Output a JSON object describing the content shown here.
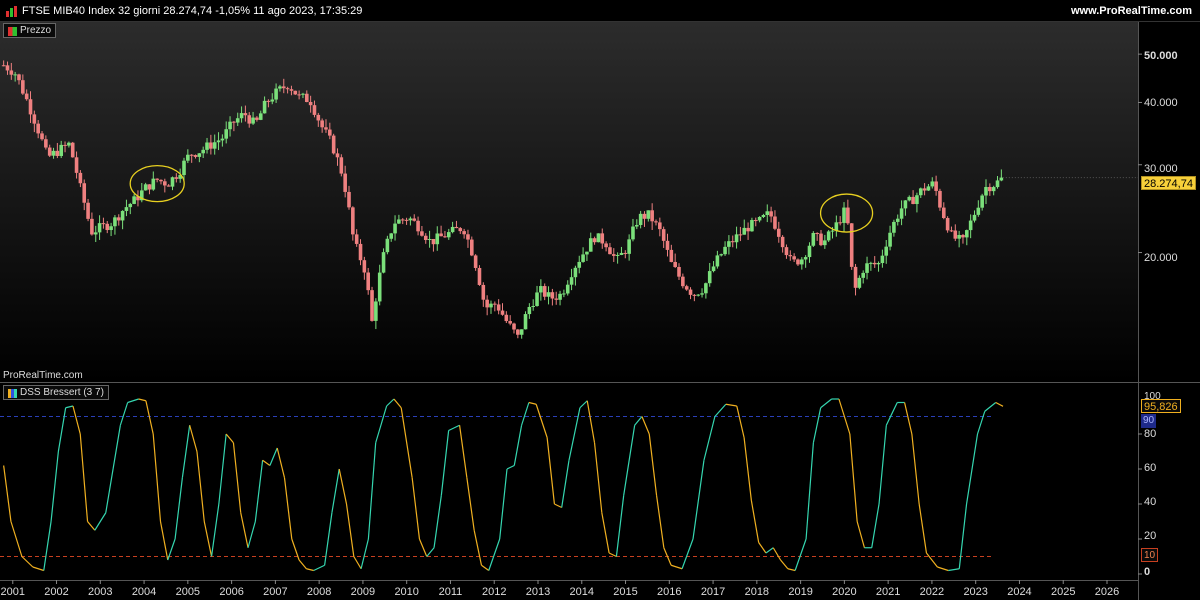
{
  "header": {
    "title": "FTSE MIB40 Index 32 giorni 28.274,74 -1,05% 11 ago 2023, 17:35:29",
    "site": "www.ProRealTime.com"
  },
  "price_panel": {
    "legend": "Prezzo",
    "watermark": "ProRealTime.com",
    "y_ticks": [
      "50.000",
      "40.000",
      "30.000",
      "20.000"
    ],
    "last_price": "28.274,74"
  },
  "indicator_panel": {
    "legend": "DSS Bressert (3 7)",
    "y_ticks": [
      "80",
      "60",
      "40",
      "20",
      "0"
    ],
    "top_tick": "100",
    "last_value": "95,826",
    "upper_level": "90",
    "lower_level": "10"
  },
  "x_axis": {
    "years": [
      "2001",
      "2002",
      "2003",
      "2004",
      "2005",
      "2006",
      "2007",
      "2008",
      "2009",
      "2010",
      "2011",
      "2012",
      "2013",
      "2014",
      "2015",
      "2016",
      "2017",
      "2018",
      "2019",
      "2020",
      "2021",
      "2022",
      "2023",
      "2024",
      "2025",
      "2026"
    ]
  },
  "colors": {
    "up": "#7be07b",
    "down": "#ef8080",
    "highlight": "#e8d020",
    "dss_up": "#35d6b0",
    "dss_down": "#f0b020",
    "upper_line": "#2a3fb8",
    "lower_line": "#c84020",
    "price_tag_bg": "#f7d03a",
    "grid_bg_top": "#2c2c2c"
  },
  "chart_data": [
    {
      "type": "candlestick",
      "title": "FTSE MIB40 Index 32 giorni",
      "scale": "log",
      "ylim": [
        11000,
        58000
      ],
      "x_range": [
        "2000-09",
        "2026-09"
      ],
      "closes": [
        [
          "2000-10",
          47500
        ],
        [
          "2001-01",
          46000
        ],
        [
          "2001-04",
          41000
        ],
        [
          "2001-07",
          36000
        ],
        [
          "2001-10",
          31000
        ],
        [
          "2002-01",
          32000
        ],
        [
          "2002-04",
          33000
        ],
        [
          "2002-07",
          27000
        ],
        [
          "2002-10",
          22000
        ],
        [
          "2003-01",
          22500
        ],
        [
          "2003-04",
          23000
        ],
        [
          "2003-07",
          24500
        ],
        [
          "2003-10",
          25500
        ],
        [
          "2004-01",
          27000
        ],
        [
          "2004-04",
          28000
        ],
        [
          "2004-07",
          27500
        ],
        [
          "2004-10",
          29000
        ],
        [
          "2005-01",
          31500
        ],
        [
          "2005-04",
          32000
        ],
        [
          "2005-07",
          33000
        ],
        [
          "2005-10",
          34000
        ],
        [
          "2006-01",
          36500
        ],
        [
          "2006-04",
          38000
        ],
        [
          "2006-07",
          36000
        ],
        [
          "2006-10",
          40000
        ],
        [
          "2007-01",
          42000
        ],
        [
          "2007-04",
          43500
        ],
        [
          "2007-07",
          41000
        ],
        [
          "2007-10",
          40500
        ],
        [
          "2008-01",
          36000
        ],
        [
          "2008-04",
          33000
        ],
        [
          "2008-07",
          28500
        ],
        [
          "2008-10",
          21000
        ],
        [
          "2009-01",
          18500
        ],
        [
          "2009-03",
          14500
        ],
        [
          "2009-06",
          19500
        ],
        [
          "2009-09",
          23000
        ],
        [
          "2010-01",
          23500
        ],
        [
          "2010-04",
          22500
        ],
        [
          "2010-07",
          21000
        ],
        [
          "2010-10",
          21500
        ],
        [
          "2011-01",
          22000
        ],
        [
          "2011-04",
          22500
        ],
        [
          "2011-07",
          19500
        ],
        [
          "2011-10",
          15500
        ],
        [
          "2012-01",
          15800
        ],
        [
          "2012-04",
          14500
        ],
        [
          "2012-07",
          13500
        ],
        [
          "2012-10",
          15500
        ],
        [
          "2013-01",
          16800
        ],
        [
          "2013-04",
          16200
        ],
        [
          "2013-07",
          16500
        ],
        [
          "2013-10",
          18500
        ],
        [
          "2014-01",
          20000
        ],
        [
          "2014-04",
          21500
        ],
        [
          "2014-07",
          21000
        ],
        [
          "2014-10",
          19200
        ],
        [
          "2015-01",
          20500
        ],
        [
          "2015-04",
          23500
        ],
        [
          "2015-07",
          23800
        ],
        [
          "2015-10",
          22000
        ],
        [
          "2016-01",
          19000
        ],
        [
          "2016-04",
          17500
        ],
        [
          "2016-07",
          16500
        ],
        [
          "2016-10",
          17000
        ],
        [
          "2017-01",
          19000
        ],
        [
          "2017-04",
          20500
        ],
        [
          "2017-07",
          21500
        ],
        [
          "2017-10",
          22500
        ],
        [
          "2018-01",
          23000
        ],
        [
          "2018-04",
          24000
        ],
        [
          "2018-07",
          21500
        ],
        [
          "2018-10",
          19000
        ],
        [
          "2019-01",
          19500
        ],
        [
          "2019-04",
          21500
        ],
        [
          "2019-07",
          21000
        ],
        [
          "2019-10",
          22500
        ],
        [
          "2020-01",
          24500
        ],
        [
          "2020-03",
          16500
        ],
        [
          "2020-06",
          18800
        ],
        [
          "2020-10",
          19000
        ],
        [
          "2021-01",
          22000
        ],
        [
          "2021-04",
          24500
        ],
        [
          "2021-07",
          25500
        ],
        [
          "2021-10",
          26800
        ],
        [
          "2022-01",
          27500
        ],
        [
          "2022-03",
          24500
        ],
        [
          "2022-06",
          21500
        ],
        [
          "2022-09",
          21000
        ],
        [
          "2022-12",
          23800
        ],
        [
          "2023-03",
          27000
        ],
        [
          "2023-06",
          27500
        ],
        [
          "2023-08",
          28274.74
        ]
      ]
    },
    {
      "type": "line",
      "title": "DSS Bressert (3 7)",
      "ylim": [
        0,
        100
      ],
      "levels": [
        90,
        10
      ],
      "series": [
        {
          "name": "DSS Bressert (3 7)",
          "points": [
            [
              "2000-10",
              62
            ],
            [
              "2000-12",
              30
            ],
            [
              "2001-03",
              10
            ],
            [
              "2001-06",
              4
            ],
            [
              "2001-09",
              2
            ],
            [
              "2001-11",
              30
            ],
            [
              "2002-01",
              70
            ],
            [
              "2002-03",
              95
            ],
            [
              "2002-05",
              96
            ],
            [
              "2002-07",
              80
            ],
            [
              "2002-09",
              30
            ],
            [
              "2002-11",
              25
            ],
            [
              "2003-02",
              35
            ],
            [
              "2003-04",
              60
            ],
            [
              "2003-06",
              85
            ],
            [
              "2003-08",
              98
            ],
            [
              "2003-11",
              100
            ],
            [
              "2004-01",
              99
            ],
            [
              "2004-03",
              80
            ],
            [
              "2004-05",
              30
            ],
            [
              "2004-07",
              8
            ],
            [
              "2004-09",
              20
            ],
            [
              "2004-11",
              55
            ],
            [
              "2005-01",
              85
            ],
            [
              "2005-03",
              70
            ],
            [
              "2005-05",
              30
            ],
            [
              "2005-07",
              10
            ],
            [
              "2005-09",
              40
            ],
            [
              "2005-11",
              80
            ],
            [
              "2006-01",
              75
            ],
            [
              "2006-03",
              35
            ],
            [
              "2006-05",
              15
            ],
            [
              "2006-07",
              30
            ],
            [
              "2006-09",
              65
            ],
            [
              "2006-11",
              62
            ],
            [
              "2007-01",
              72
            ],
            [
              "2007-03",
              55
            ],
            [
              "2007-05",
              20
            ],
            [
              "2007-07",
              8
            ],
            [
              "2007-09",
              3
            ],
            [
              "2007-11",
              2
            ],
            [
              "2008-02",
              5
            ],
            [
              "2008-04",
              35
            ],
            [
              "2008-06",
              60
            ],
            [
              "2008-08",
              40
            ],
            [
              "2008-10",
              10
            ],
            [
              "2008-12",
              3
            ],
            [
              "2009-02",
              20
            ],
            [
              "2009-04",
              75
            ],
            [
              "2009-07",
              96
            ],
            [
              "2009-09",
              100
            ],
            [
              "2009-11",
              95
            ],
            [
              "2010-02",
              55
            ],
            [
              "2010-04",
              20
            ],
            [
              "2010-06",
              10
            ],
            [
              "2010-08",
              15
            ],
            [
              "2010-10",
              45
            ],
            [
              "2010-12",
              82
            ],
            [
              "2011-03",
              85
            ],
            [
              "2011-05",
              55
            ],
            [
              "2011-07",
              25
            ],
            [
              "2011-09",
              5
            ],
            [
              "2011-11",
              2
            ],
            [
              "2012-02",
              20
            ],
            [
              "2012-04",
              60
            ],
            [
              "2012-06",
              62
            ],
            [
              "2012-08",
              85
            ],
            [
              "2012-10",
              98
            ],
            [
              "2012-12",
              97
            ],
            [
              "2013-03",
              78
            ],
            [
              "2013-05",
              40
            ],
            [
              "2013-07",
              38
            ],
            [
              "2013-09",
              65
            ],
            [
              "2013-12",
              95
            ],
            [
              "2014-02",
              99
            ],
            [
              "2014-04",
              75
            ],
            [
              "2014-06",
              35
            ],
            [
              "2014-08",
              12
            ],
            [
              "2014-10",
              10
            ],
            [
              "2014-12",
              45
            ],
            [
              "2015-03",
              85
            ],
            [
              "2015-05",
              90
            ],
            [
              "2015-07",
              80
            ],
            [
              "2015-09",
              45
            ],
            [
              "2015-11",
              15
            ],
            [
              "2016-01",
              5
            ],
            [
              "2016-04",
              3
            ],
            [
              "2016-07",
              20
            ],
            [
              "2016-10",
              65
            ],
            [
              "2017-01",
              90
            ],
            [
              "2017-04",
              97
            ],
            [
              "2017-07",
              96
            ],
            [
              "2017-09",
              78
            ],
            [
              "2017-11",
              42
            ],
            [
              "2018-01",
              18
            ],
            [
              "2018-03",
              12
            ],
            [
              "2018-05",
              15
            ],
            [
              "2018-07",
              8
            ],
            [
              "2018-09",
              3
            ],
            [
              "2018-11",
              2
            ],
            [
              "2019-02",
              20
            ],
            [
              "2019-04",
              75
            ],
            [
              "2019-06",
              95
            ],
            [
              "2019-09",
              100
            ],
            [
              "2019-11",
              100
            ],
            [
              "2020-02",
              80
            ],
            [
              "2020-04",
              30
            ],
            [
              "2020-06",
              15
            ],
            [
              "2020-08",
              15
            ],
            [
              "2020-10",
              40
            ],
            [
              "2020-12",
              85
            ],
            [
              "2021-03",
              98
            ],
            [
              "2021-05",
              98
            ],
            [
              "2021-07",
              80
            ],
            [
              "2021-09",
              40
            ],
            [
              "2021-11",
              12
            ],
            [
              "2022-02",
              4
            ],
            [
              "2022-05",
              2
            ],
            [
              "2022-08",
              3
            ],
            [
              "2022-10",
              40
            ],
            [
              "2023-01",
              80
            ],
            [
              "2023-03",
              93
            ],
            [
              "2023-06",
              98
            ],
            [
              "2023-08",
              95.826
            ]
          ]
        }
      ]
    }
  ]
}
